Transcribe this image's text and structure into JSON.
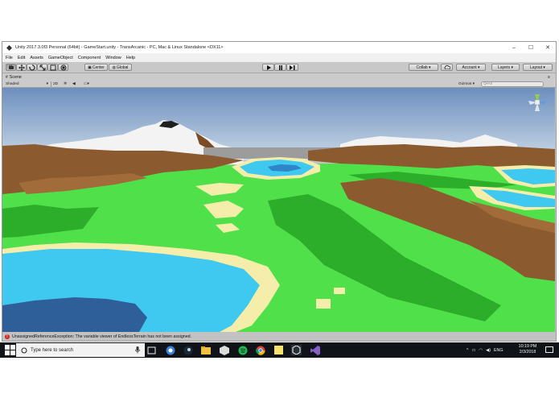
{
  "window": {
    "title": "Unity 2017.3.0f3 Personal (64bit) - GameStart.unity - TransArcanic - PC, Mac & Linux Standalone <DX11>"
  },
  "menu": [
    "File",
    "Edit",
    "Assets",
    "GameObject",
    "Component",
    "Window",
    "Help"
  ],
  "toolbar": {
    "center_label": "Center",
    "global_label": "Global",
    "collab_label": "Collab ▾",
    "account_label": "Account ▾",
    "layers_label": "Layers ▾",
    "layout_label": "Layout ▾"
  },
  "scene": {
    "tab_label": "Scene",
    "shading_mode": "Shaded",
    "mode_2d": "2D",
    "gizmos_label": "Gizmos ▾",
    "search_placeholder": "Q•All"
  },
  "status": {
    "error_message": "UnassignedReferenceException: The variable viewer of EndlessTerrain has not been assigned."
  },
  "taskbar": {
    "search_placeholder": "Type here to search",
    "language": "ENG",
    "time": "10:19 PM",
    "date": "2/3/2018"
  },
  "colors": {
    "sky_top": "#6d8fbf",
    "sky_horizon": "#c9d8e6",
    "grass": "#4fe04a",
    "dark_grass": "#2cae2b",
    "dirt": "#8b5a2e",
    "water": "#3fc8f0",
    "deep_water": "#2e5f99",
    "sand": "#f4eeaa",
    "snow": "#f4f4f4"
  }
}
